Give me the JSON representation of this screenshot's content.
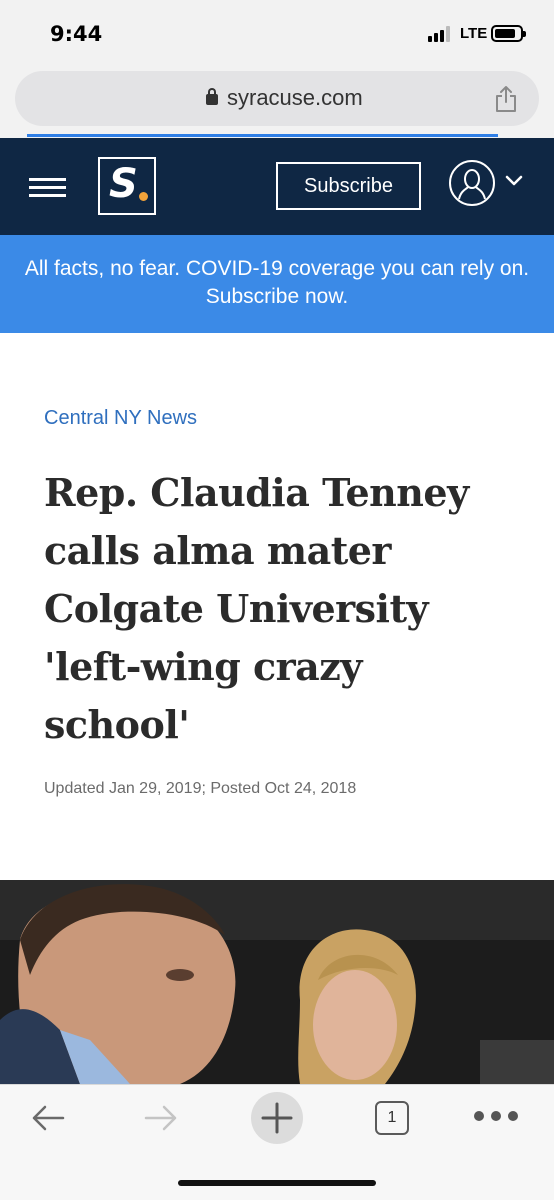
{
  "status": {
    "time": "9:44",
    "network": "LTE"
  },
  "browser": {
    "url": "syracuse.com"
  },
  "header": {
    "logo_letter": "S.",
    "subscribe_label": "Subscribe"
  },
  "banner": {
    "text": "All facts, no fear. COVID-19 coverage you can rely on. Subscribe now."
  },
  "article": {
    "section": "Central NY News",
    "headline": "Rep. Claudia Tenney calls alma mater Colgate University 'left-wing crazy school'",
    "dateline": "Updated Jan 29, 2019; Posted Oct 24, 2018"
  },
  "toolbar": {
    "tab_count": "1"
  },
  "colors": {
    "header_bg": "#0f2744",
    "banner_bg": "#3b8ae7",
    "kicker": "#2f6fbe",
    "logo_dot": "#f2a33a"
  }
}
